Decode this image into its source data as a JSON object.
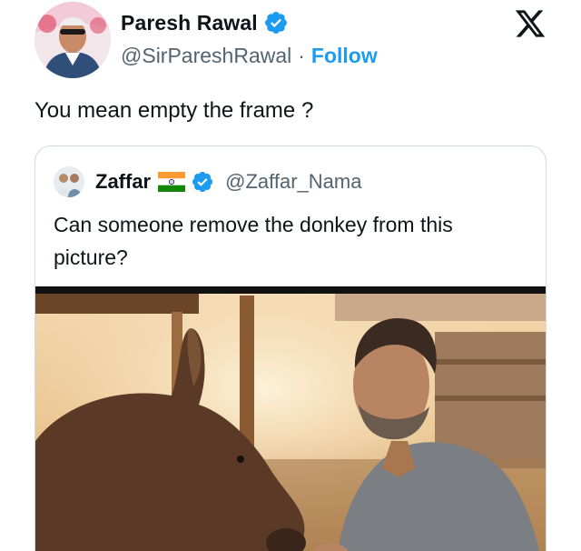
{
  "author": {
    "name": "Paresh Rawal",
    "handle": "@SirPareshRawal",
    "separator": "·",
    "follow_label": "Follow",
    "verified_color": "#1d9bf0"
  },
  "tweet": {
    "text": "You mean empty the frame ?"
  },
  "quoted_tweet": {
    "name": "Zaffar",
    "handle": "@Zaffar_Nama",
    "text": "Can someone remove the donkey from this picture?"
  },
  "colors": {
    "link": "#1d9bf0",
    "secondary_text": "#536471",
    "border": "#cfd9de"
  },
  "icons": {
    "logo": "x-logo-icon",
    "verified": "verified-badge-icon",
    "flag": "india-flag-icon"
  }
}
